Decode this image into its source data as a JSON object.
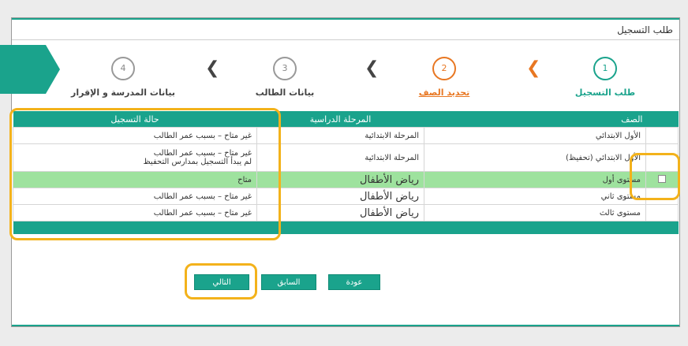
{
  "page": {
    "title": "طلب التسجيل"
  },
  "steps": [
    {
      "number": "1",
      "label": "طلب التسجيل",
      "state": "done"
    },
    {
      "number": "2",
      "label": "تحديد الصف",
      "state": "active"
    },
    {
      "number": "3",
      "label": "بيانات الطالب",
      "state": "pending"
    },
    {
      "number": "4",
      "label": "بيانات المدرسة و الإقرار",
      "state": "pending"
    }
  ],
  "colors": {
    "accent": "#1aa38c",
    "active": "#e87722",
    "pending": "#999999",
    "highlight": "#f3b21b",
    "selected_row": "#9ee29e"
  },
  "table": {
    "headers": {
      "class": "الصف",
      "stage": "المرحلة الدراسية",
      "status": "حالة التسجيل"
    },
    "rows": [
      {
        "checkbox": false,
        "class": "الأول الابتدائي",
        "stage": "المرحلة الابتدائية",
        "status_line1": "غير متاح – بسبب عمر الطالب",
        "status_line2": ""
      },
      {
        "checkbox": false,
        "class": "الأول الابتدائي (تحفيظ)",
        "stage": "المرحلة الابتدائية",
        "status_line1": "غير متاح – بسبب عمر الطالب",
        "status_line2": "لم يبدأ التسجيل بمدارس التحفيظ"
      },
      {
        "checkbox": true,
        "class": "مستوى أول",
        "stage": "رياض الأطفال",
        "status_line1": "متاح",
        "status_line2": ""
      },
      {
        "checkbox": false,
        "class": "مستوى ثاني",
        "stage": "رياض الأطفال",
        "status_line1": "غير متاح – بسبب عمر الطالب",
        "status_line2": ""
      },
      {
        "checkbox": false,
        "class": "مستوى ثالث",
        "stage": "رياض الأطفال",
        "status_line1": "غير متاح – بسبب عمر الطالب",
        "status_line2": ""
      }
    ]
  },
  "buttons": {
    "next": "التالي",
    "previous": "السابق",
    "back": "عودة"
  }
}
